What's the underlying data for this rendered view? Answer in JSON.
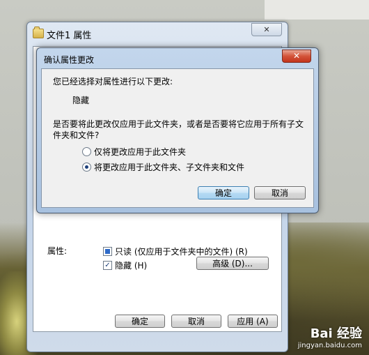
{
  "properties_window": {
    "title": "文件1 属性",
    "attributes_label": "属性:",
    "readonly_label": "只读 (仅应用于文件夹中的文件) (R)",
    "hidden_label": "隐藏 (H)",
    "advanced_button": "高级 (D)...",
    "ok_button": "确定",
    "cancel_button": "取消",
    "apply_button": "应用 (A)",
    "close_glyph": "✕"
  },
  "confirm_dialog": {
    "title": "确认属性更改",
    "close_glyph": "✕",
    "message": "您已经选择对属性进行以下更改:",
    "change_item": "隐藏",
    "question": "是否要将此更改仅应用于此文件夹，或者是否要将它应用于所有子文件夹和文件?",
    "option_folder_only": "仅将更改应用于此文件夹",
    "option_all": "将更改应用于此文件夹、子文件夹和文件",
    "ok_button": "确定",
    "cancel_button": "取消"
  },
  "watermark": {
    "brand": "Bai 经验",
    "url": "jingyan.baidu.com"
  },
  "colors": {
    "title_bar": "#c3d6ec",
    "close_red": "#c3341b",
    "primary_button": "#b5daf3"
  }
}
